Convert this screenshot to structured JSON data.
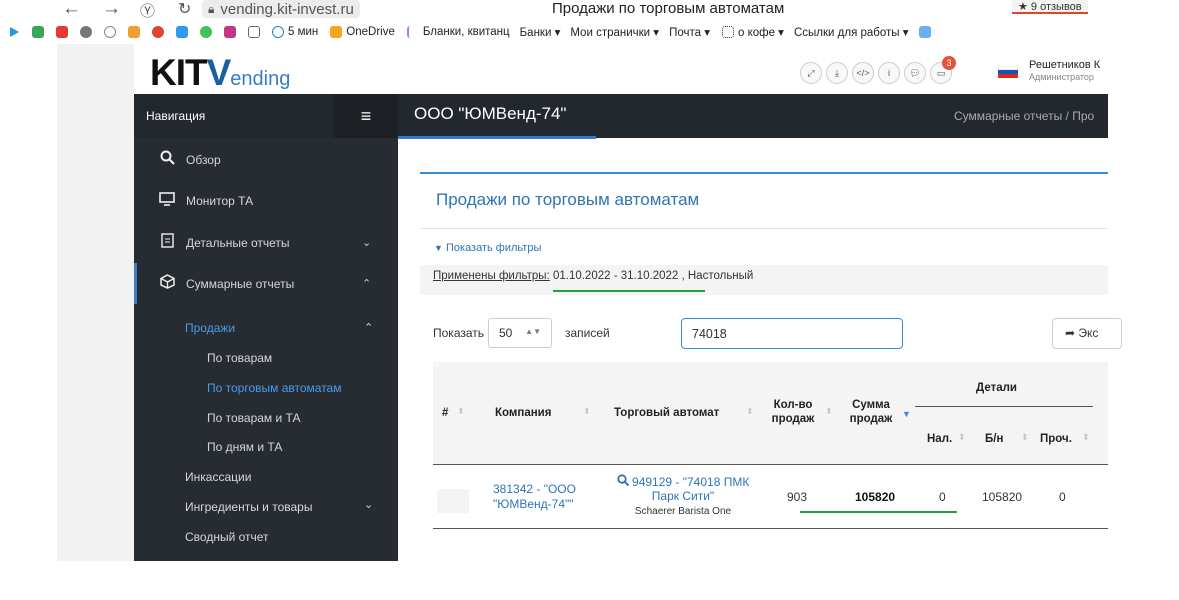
{
  "browser": {
    "url": "vending.kit-invest.ru",
    "tab_title": "Продажи по торговым автоматам",
    "reviews": "★ 9 отзывов",
    "bookmarks": [
      "5 мин",
      "OneDrive",
      "Бланки, квитанц",
      "Банки ▾",
      "Мои странички ▾",
      "Почта ▾",
      "о кофе ▾",
      "Ссылки для работы ▾"
    ]
  },
  "header": {
    "logo_kit": "KIT",
    "logo_v": "V",
    "logo_ending": "ending",
    "notification_count": "3",
    "user_name": "Решетников К",
    "user_role": "Администратор"
  },
  "sidebar": {
    "title": "Навигация",
    "items": [
      {
        "label": "Обзор",
        "icon": "search-icon"
      },
      {
        "label": "Монитор ТА",
        "icon": "monitor-icon"
      },
      {
        "label": "Детальные отчеты",
        "icon": "document-icon",
        "chevron": "⌄"
      },
      {
        "label": "Суммарные отчеты",
        "icon": "cube-icon",
        "chevron": "⌃"
      }
    ],
    "sub": {
      "sales": "Продажи",
      "by_goods": "По товарам",
      "by_machines": "По торговым автоматам",
      "by_goods_machines": "По товарам и ТА",
      "by_days_machines": "По дням и ТА",
      "collections": "Инкассации",
      "ingredients": "Ингредиенты и товары",
      "summary": "Сводный отчет"
    }
  },
  "topbar": {
    "company": "ООО \"ЮМВенд-74\"",
    "breadcrumb": "Суммарные отчеты  /  Про"
  },
  "panel": {
    "title": "Продажи по торговым автоматам",
    "show_filters": "Показать фильтры",
    "applied_label": "Применены фильтры:",
    "applied_value": " 01.10.2022 - 31.10.2022 , Настольный",
    "show_label": "Показать",
    "per_page": "50",
    "entries_label": "записей",
    "search_value": "74018",
    "export_label": "Экс"
  },
  "table": {
    "headers": {
      "num": "#",
      "company": "Компания",
      "machine": "Торговый автомат",
      "qty_line1": "Кол-во",
      "qty_line2": "продаж",
      "sum_line1": "Сумма",
      "sum_line2": "продаж",
      "details": "Детали",
      "cash": "Нал.",
      "cashless": "Б/н",
      "other": "Проч."
    },
    "rows": [
      {
        "company_line1": "381342 - \"ООО",
        "company_line2": "\"ЮМВенд-74\"\"",
        "machine_line1": "949129 - \"74018 ПМК",
        "machine_line2": "Парк Сити\"",
        "machine_model": "Schaerer Barista One",
        "qty": "903",
        "sum": "105820",
        "cash": "0",
        "cashless": "105820",
        "other": "0"
      }
    ]
  }
}
